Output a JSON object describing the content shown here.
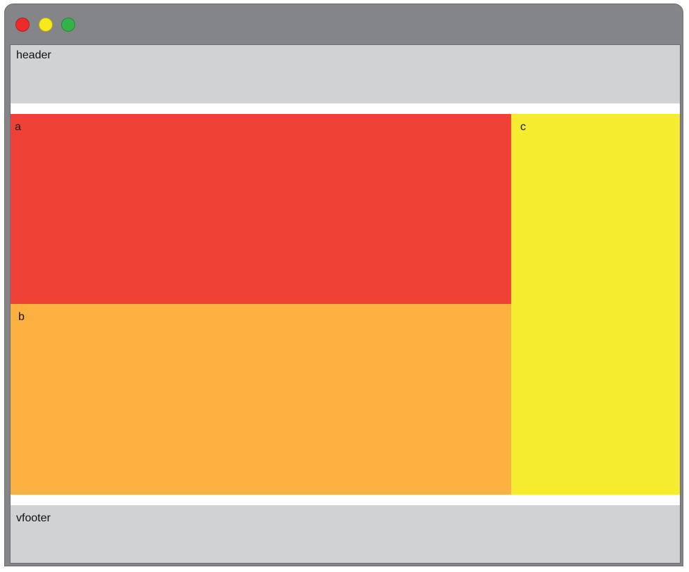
{
  "window": {
    "buttons": [
      {
        "name": "close",
        "color": "#ee2b2b"
      },
      {
        "name": "minimize",
        "color": "#f7e91b"
      },
      {
        "name": "maximize",
        "color": "#34b24a"
      }
    ],
    "frame_color": "#838588"
  },
  "layout": {
    "header": {
      "label": "header",
      "color": "#d1d2d4"
    },
    "a": {
      "label": "a",
      "color": "#ef4136"
    },
    "b": {
      "label": "b",
      "color": "#fbb040"
    },
    "c": {
      "label": "c",
      "color": "#f5ec2f"
    },
    "footer": {
      "label": "vfooter",
      "color": "#d1d2d4"
    }
  }
}
